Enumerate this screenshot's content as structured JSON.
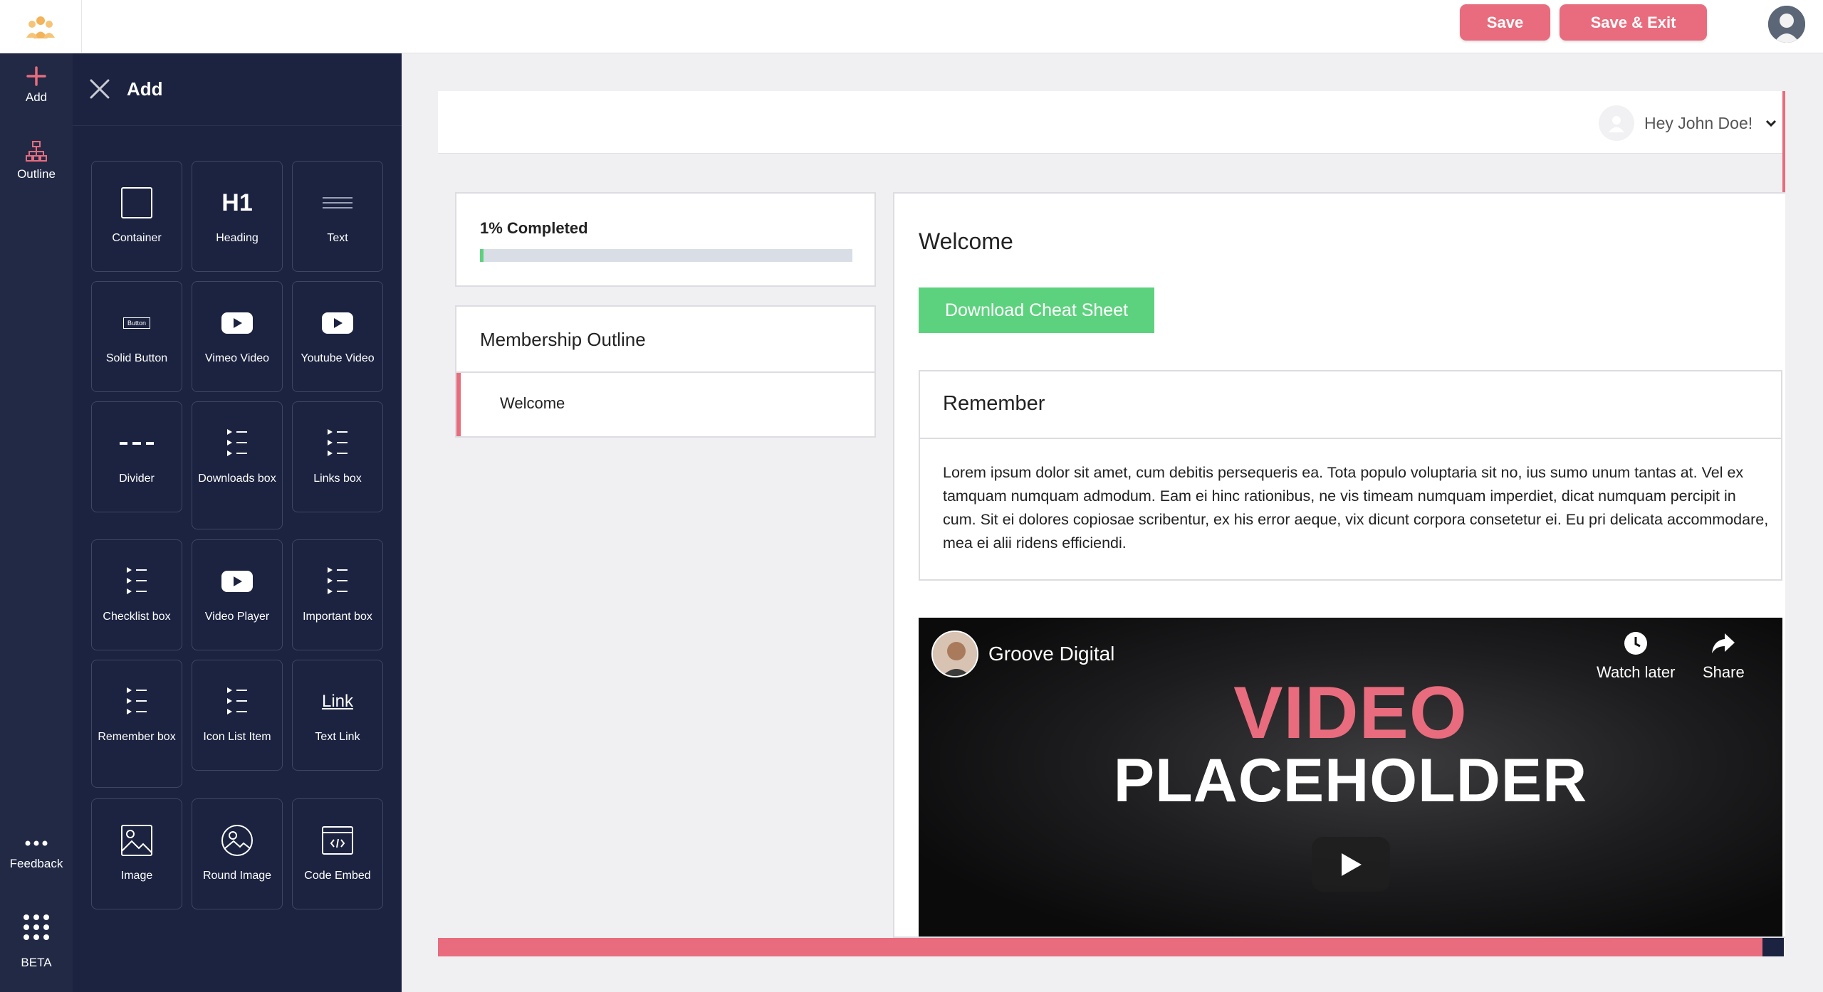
{
  "header": {
    "save_label": "Save",
    "save_exit_label": "Save & Exit",
    "logo_icon": "people-logo-icon",
    "avatar_icon": "user-avatar-icon"
  },
  "rail": {
    "add_label": "Add",
    "outline_label": "Outline",
    "feedback_label": "Feedback",
    "beta_label": "BETA"
  },
  "panel": {
    "title": "Add",
    "tiles": [
      {
        "label": "Container",
        "icon": "container-icon"
      },
      {
        "label": "Heading",
        "icon": "heading-icon",
        "glyph": "H1"
      },
      {
        "label": "Text",
        "icon": "text-icon"
      },
      {
        "label": "Solid Button",
        "icon": "button-icon",
        "glyph": "Button"
      },
      {
        "label": "Vimeo Video",
        "icon": "video-icon"
      },
      {
        "label": "Youtube Video",
        "icon": "video-icon"
      },
      {
        "label": "Divider",
        "icon": "divider-icon"
      },
      {
        "label": "Downloads box",
        "icon": "list-icon"
      },
      {
        "label": "Links box",
        "icon": "list-icon"
      },
      {
        "label": "Checklist box",
        "icon": "list-icon"
      },
      {
        "label": "Video Player",
        "icon": "video-icon"
      },
      {
        "label": "Important box",
        "icon": "list-icon"
      },
      {
        "label": "Remember box",
        "icon": "list-icon"
      },
      {
        "label": "Icon List Item",
        "icon": "list-icon"
      },
      {
        "label": "Text Link",
        "icon": "link-icon",
        "glyph": "Link"
      },
      {
        "label": "Image",
        "icon": "image-icon"
      },
      {
        "label": "Round Image",
        "icon": "round-image-icon"
      },
      {
        "label": "Code Embed",
        "icon": "code-embed-icon"
      }
    ]
  },
  "page": {
    "user_greeting": "Hey John Doe!",
    "progress_label": "1% Completed",
    "progress_value": 0.01,
    "outline_title": "Membership Outline",
    "outline_items": [
      "Welcome"
    ],
    "content_title": "Welcome",
    "download_label": "Download Cheat Sheet",
    "remember_title": "Remember",
    "remember_text": "Lorem ipsum dolor sit amet, cum debitis persequeris ea. Tota populo voluptaria sit no, ius sumo unum tantas at. Vel ex tamquam numquam admodum. Eam ei hinc rationibus, ne vis timeam numquam imperdiet, dicat numquam percipit in cum. Sit ei dolores copiosae scribentur, ex his error aeque, vix dicunt corpora consetetur ei. Eu pri delicata accommodare, mea ei alii ridens efficiendi.",
    "video": {
      "channel": "Groove Digital",
      "watch_later": "Watch later",
      "share": "Share",
      "title_line1": "VIDEO",
      "title_line2": "PLACEHOLDER"
    }
  },
  "colors": {
    "accent": "#e86c7d",
    "success": "#5dd27e",
    "sidebar": "#1c2340",
    "rail": "#212945"
  }
}
